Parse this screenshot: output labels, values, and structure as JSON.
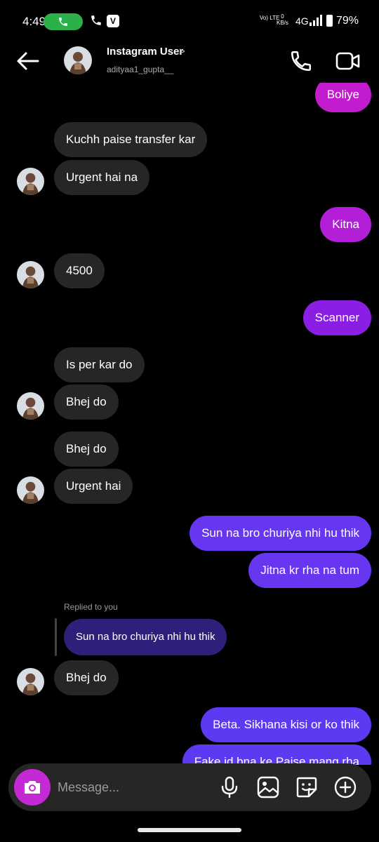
{
  "status_bar": {
    "time": "4:49",
    "volte": "Vo) LTE",
    "data_speed_value": "0",
    "data_speed_unit": "KB/s",
    "network": "4G",
    "battery": "79%"
  },
  "header": {
    "name": "Instagram User",
    "handle": "adityaa1_gupta__"
  },
  "messages": [
    {
      "side": "out",
      "text": "Boliye",
      "color": "#c21cce"
    },
    {
      "side": "in",
      "text": "Kuchh paise transfer kar"
    },
    {
      "side": "in",
      "text": "Urgent hai na"
    },
    {
      "side": "out",
      "text": "Kitna",
      "color": "#b31fd6"
    },
    {
      "side": "in",
      "text": "4500"
    },
    {
      "side": "out",
      "text": "Scanner",
      "color": "#8a1ee2"
    },
    {
      "side": "in",
      "text": "Is per kar do"
    },
    {
      "side": "in",
      "text": "Bhej do"
    },
    {
      "side": "in",
      "text": "Bhej do"
    },
    {
      "side": "in",
      "text": "Urgent hai"
    },
    {
      "side": "out",
      "text": "Sun na bro churiya nhi hu thik",
      "color": "#6636f0"
    },
    {
      "side": "out",
      "text": "Jitna kr rha na tum",
      "color": "#6636f0"
    },
    {
      "side": "in",
      "text": "Bhej do",
      "reply_label": "Replied to you",
      "quoted": "Sun na bro churiya nhi hu thik"
    },
    {
      "side": "out",
      "text": "Beta. Sikhana kisi or ko thik",
      "color": "#5b3af2"
    },
    {
      "side": "out",
      "text": "Fake id bna ke Paise mang rha",
      "color": "#5b3af2"
    }
  ],
  "composer": {
    "placeholder": "Message..."
  },
  "colors": {
    "incoming": "#262626",
    "camera": "#c42ad4",
    "call_pill": "#2bb04a"
  }
}
